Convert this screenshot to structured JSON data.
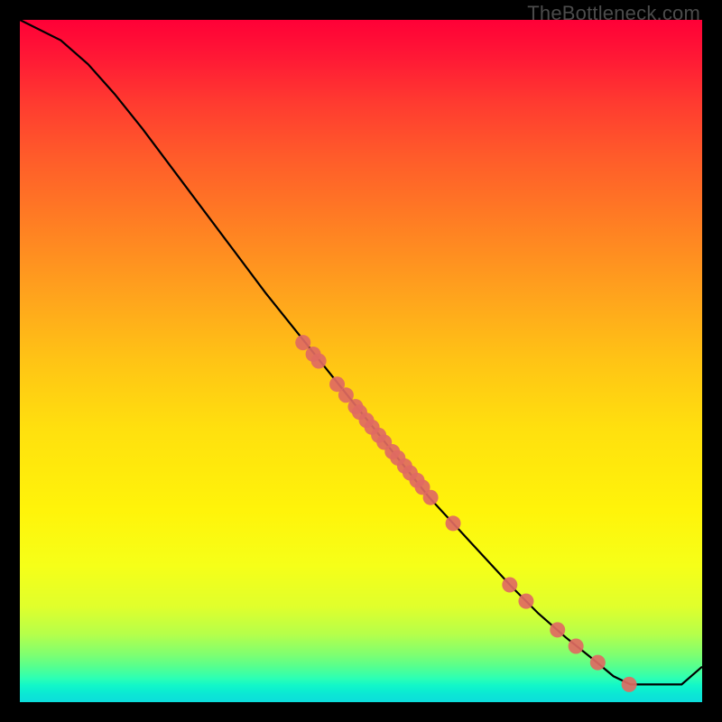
{
  "watermark": "TheBottleneck.com",
  "chart_data": {
    "type": "line",
    "title": "",
    "xlabel": "",
    "ylabel": "",
    "xlim": [
      0,
      100
    ],
    "ylim": [
      0,
      100
    ],
    "grid": false,
    "series": [
      {
        "name": "curve",
        "x": [
          0,
          6,
          10,
          14,
          18,
          24,
          30,
          36,
          42,
          48,
          54,
          60,
          66,
          72,
          76,
          80,
          84,
          87,
          89.5,
          94,
          97,
          100
        ],
        "y": [
          100,
          97,
          93.5,
          89,
          84,
          76,
          68,
          60,
          52.5,
          45,
          37.5,
          30,
          23.5,
          17,
          13,
          9.5,
          6.3,
          3.8,
          2.6,
          2.6,
          2.6,
          5.2
        ]
      }
    ],
    "points": {
      "name": "dots",
      "color": "#e06a62",
      "x": [
        41.5,
        43,
        43.8,
        46.5,
        47.8,
        49.2,
        49.8,
        50.8,
        51.6,
        52.6,
        53.4,
        54.6,
        55.4,
        56.4,
        57.2,
        58.2,
        59,
        60.2,
        63.5,
        71.8,
        74.2,
        78.8,
        81.5,
        84.7,
        89.3
      ],
      "y": [
        52.7,
        51.0,
        50.0,
        46.6,
        45.0,
        43.3,
        42.5,
        41.3,
        40.3,
        39.1,
        38.1,
        36.7,
        35.8,
        34.6,
        33.6,
        32.5,
        31.5,
        30.0,
        26.2,
        17.2,
        14.8,
        10.6,
        8.2,
        5.8,
        2.6
      ]
    }
  },
  "styling": {
    "line_color": "#000000",
    "line_width": 2.2,
    "dot_radius": 8.5,
    "dot_fill": "#e06a62",
    "dot_opacity": 0.92
  }
}
